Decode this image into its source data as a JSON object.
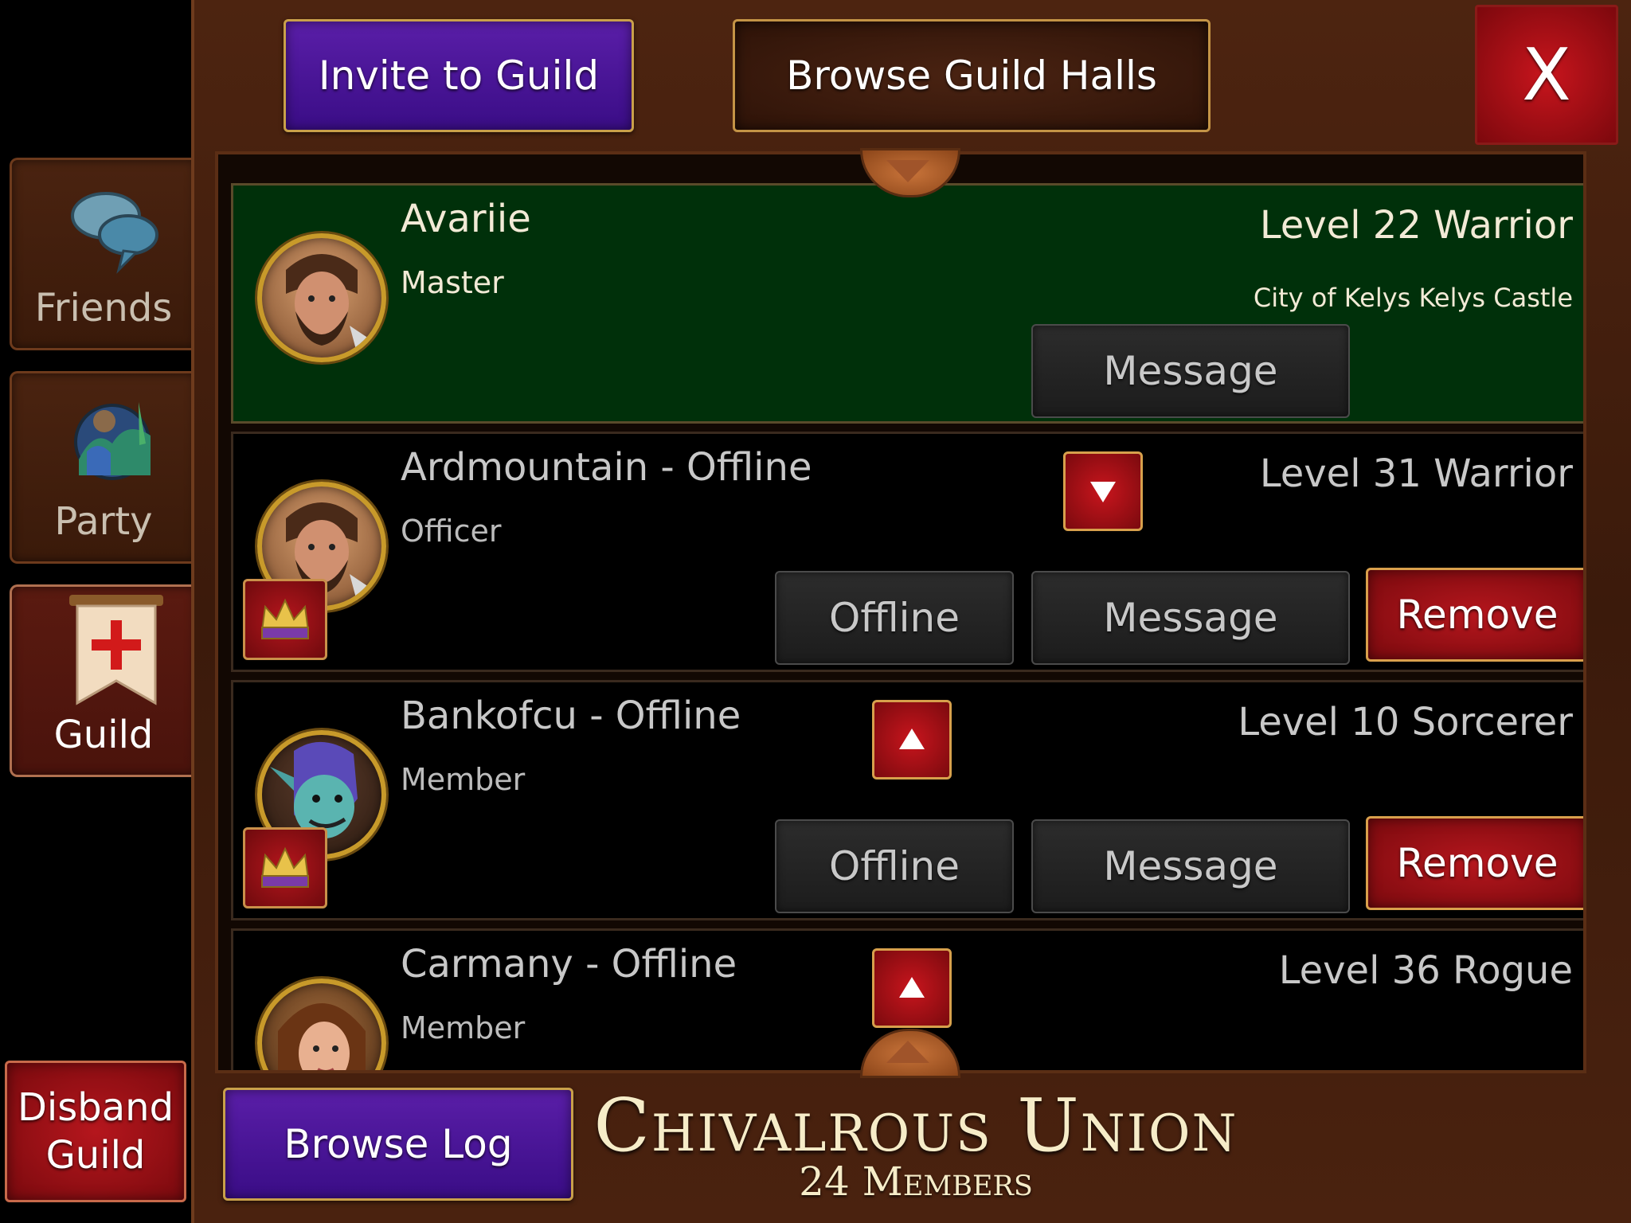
{
  "side_tabs": [
    {
      "label": "Friends",
      "icon": "speech-bubbles-icon",
      "active": false
    },
    {
      "label": "Party",
      "icon": "party-group-icon",
      "active": false
    },
    {
      "label": "Guild",
      "icon": "guild-banner-icon",
      "active": true
    }
  ],
  "disband_button": {
    "line1": "Disband",
    "line2": "Guild"
  },
  "header": {
    "invite_label": "Invite to Guild",
    "browse_halls_label": "Browse Guild Halls",
    "close_label": "X"
  },
  "members": [
    {
      "name": "Avariie",
      "rank": "Master",
      "level": "Level 22 Warrior",
      "location": "City of Kelys Kelys Castle",
      "avatar": "bearded-warrior-portrait",
      "message_label": "Message"
    },
    {
      "name": "Ardmountain - Offline",
      "rank": "Officer",
      "level": "Level 31 Warrior",
      "avatar": "bearded-warrior-portrait",
      "badge": "crown-icon",
      "rank_arrow": "demote-arrow-down",
      "status_label": "Offline",
      "message_label": "Message",
      "remove_label": "Remove"
    },
    {
      "name": "Bankofcu - Offline",
      "rank": "Member",
      "level": "Level 10 Sorcerer",
      "avatar": "goblin-sorcerer-portrait",
      "badge": "crown-icon",
      "rank_arrow": "promote-arrow-up",
      "status_label": "Offline",
      "message_label": "Message",
      "remove_label": "Remove"
    },
    {
      "name": "Carmany - Offline",
      "rank": "Member",
      "level": "Level 36 Rogue",
      "avatar": "female-rogue-portrait",
      "rank_arrow": "promote-arrow-up"
    }
  ],
  "footer": {
    "browse_log_label": "Browse Log",
    "guild_name": "Chivalrous Union",
    "member_count": "24 Members"
  },
  "colors": {
    "panel_brown": "#3b1a0b",
    "highlight_row": "#00300a",
    "purple_button": "#4a1596",
    "red_button": "#a0121a",
    "gold_border": "#c9a04a"
  }
}
